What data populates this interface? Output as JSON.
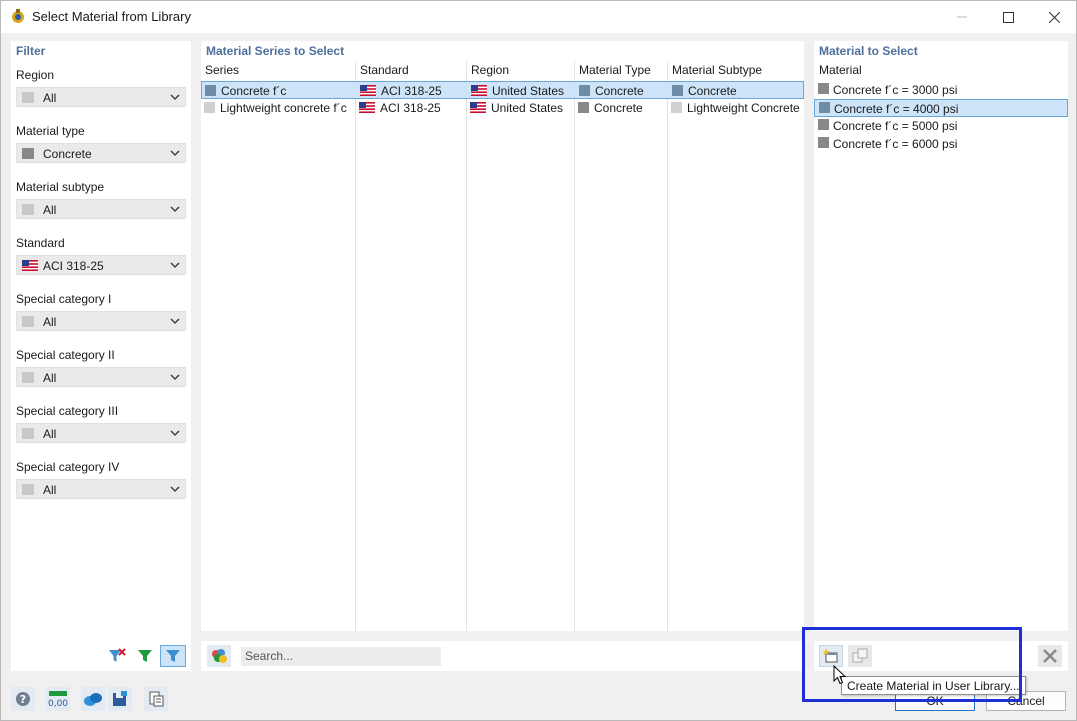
{
  "window": {
    "title": "Select Material from Library"
  },
  "filter": {
    "header": "Filter",
    "fields": [
      {
        "label": "Region",
        "value": "All",
        "swatch": "#c8c8c8",
        "flag": false
      },
      {
        "label": "Material type",
        "value": "Concrete",
        "swatch": "#888888",
        "flag": false
      },
      {
        "label": "Material subtype",
        "value": "All",
        "swatch": "#c8c8c8",
        "flag": false
      },
      {
        "label": "Standard",
        "value": "ACI 318-25",
        "swatch": "",
        "flag": true
      },
      {
        "label": "Special category I",
        "value": "All",
        "swatch": "#c8c8c8",
        "flag": false
      },
      {
        "label": "Special category II",
        "value": "All",
        "swatch": "#c8c8c8",
        "flag": false
      },
      {
        "label": "Special category III",
        "value": "All",
        "swatch": "#c8c8c8",
        "flag": false
      },
      {
        "label": "Special category IV",
        "value": "All",
        "swatch": "#c8c8c8",
        "flag": false
      }
    ]
  },
  "series": {
    "header": "Material Series to Select",
    "columns": [
      "Series",
      "Standard",
      "Region",
      "Material Type",
      "Material Subtype"
    ],
    "rows": [
      {
        "series": "Concrete f´c",
        "series_swatch": "#6f8ca6",
        "standard": "ACI 318-25",
        "region": "United States",
        "type": "Concrete",
        "type_swatch": "#6f8ca6",
        "subtype": "Concrete",
        "subtype_swatch": "#6f8ca6",
        "selected": true
      },
      {
        "series": "Lightweight concrete f´c",
        "series_swatch": "#d0d0d0",
        "standard": "ACI 318-25",
        "region": "United States",
        "type": "Concrete",
        "type_swatch": "#888888",
        "subtype": "Lightweight Concrete",
        "subtype_swatch": "#d0d0d0",
        "selected": false
      }
    ],
    "search_placeholder": "Search..."
  },
  "material": {
    "header": "Material to Select",
    "column": "Material",
    "items": [
      {
        "label": "Concrete f´c = 3000 psi",
        "selected": false
      },
      {
        "label": "Concrete f´c = 4000 psi",
        "selected": true
      },
      {
        "label": "Concrete f´c = 5000 psi",
        "selected": false
      },
      {
        "label": "Concrete f´c = 6000 psi",
        "selected": false
      }
    ],
    "tooltip": "Create Material in User Library..."
  },
  "buttons": {
    "ok": "OK",
    "cancel": "Cancel"
  },
  "colors": {
    "accent": "#4f6f9c",
    "selection": "#cde4f8",
    "highlight_box": "#1f2fd6"
  }
}
